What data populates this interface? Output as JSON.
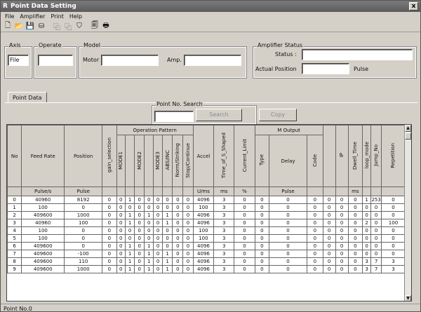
{
  "window": {
    "title": "Point Data Setting",
    "app_icon": "R",
    "close_label": "x"
  },
  "menu": [
    "File",
    "Amplifier",
    "Print",
    "Help"
  ],
  "toolbar": {
    "icons": [
      "new-file-icon",
      "open-folder-icon",
      "save-icon",
      "read-icon",
      "copy-icon",
      "paste-icon",
      "filter-icon",
      "print-preview-icon",
      "print-icon"
    ],
    "glyphs": [
      "🗋",
      "📂",
      "💾",
      "⛁",
      "⿻",
      "⿻",
      "⛉",
      "🗐",
      "🖶"
    ]
  },
  "axis": {
    "label": "Axis",
    "value": "File"
  },
  "operate": {
    "label": "Operate",
    "value": ""
  },
  "model": {
    "label": "Model",
    "motor_label": "Motor",
    "motor_value": "",
    "amp_label": "Amp.",
    "amp_value": ""
  },
  "amp_status": {
    "label": "Amplifier Status",
    "status_label": "Status :",
    "status_value": "",
    "pos_label": "Actual Position",
    "pos_value": "",
    "unit": "Pulse"
  },
  "tab": {
    "label": "Point Data"
  },
  "search": {
    "label": "Point No. Search",
    "value": "",
    "button": "Search"
  },
  "copy_button": "Copy",
  "grid": {
    "group_op": "Operation Pattern",
    "group_m": "M Output",
    "headers": [
      "No",
      "Feed Rate",
      "Position",
      "gain_selection",
      "MODE1",
      "",
      "MODE2",
      "",
      "MODE3",
      "ABS/INC",
      "Norm/Striking",
      "Stop/Continue",
      "Accel",
      "Time_of_S_Shaped",
      "Current_Limit",
      "Type",
      "Delay",
      "Code",
      "",
      "IP",
      "Dwell_Time",
      "loop_mode",
      "Jump_No",
      "Repetition"
    ],
    "units": [
      "",
      "Pulse/s",
      "Pulse",
      "",
      "",
      "",
      "",
      "",
      "",
      "",
      "",
      "",
      "U/ms",
      "ms",
      "%",
      "",
      "Pulse",
      "",
      "",
      "",
      "ms",
      "",
      "",
      ""
    ],
    "rows": [
      [
        "0",
        "40960",
        "8192",
        "0",
        "0",
        "1",
        "0",
        "0",
        "0",
        "0",
        "0",
        "0",
        "4096",
        "3",
        "0",
        "0",
        "0",
        "0",
        "0",
        "0",
        "0",
        "1",
        "253",
        "0"
      ],
      [
        "1",
        "100",
        "0",
        "0",
        "0",
        "0",
        "0",
        "0",
        "0",
        "0",
        "0",
        "0",
        "100",
        "3",
        "0",
        "0",
        "0",
        "0",
        "0",
        "0",
        "0",
        "0",
        "0",
        "0"
      ],
      [
        "2",
        "409600",
        "1000",
        "0",
        "0",
        "1",
        "0",
        "1",
        "0",
        "1",
        "0",
        "0",
        "4096",
        "3",
        "0",
        "0",
        "0",
        "0",
        "0",
        "0",
        "0",
        "0",
        "0",
        "0"
      ],
      [
        "3",
        "40960",
        "100",
        "0",
        "0",
        "1",
        "0",
        "0",
        "0",
        "1",
        "0",
        "0",
        "4096",
        "3",
        "0",
        "0",
        "0",
        "0",
        "0",
        "0",
        "0",
        "2",
        "0",
        "100"
      ],
      [
        "4",
        "100",
        "0",
        "0",
        "0",
        "0",
        "0",
        "0",
        "0",
        "0",
        "0",
        "0",
        "100",
        "3",
        "0",
        "0",
        "0",
        "0",
        "0",
        "0",
        "0",
        "0",
        "0",
        "0"
      ],
      [
        "5",
        "100",
        "0",
        "0",
        "0",
        "0",
        "0",
        "0",
        "0",
        "0",
        "0",
        "0",
        "100",
        "3",
        "0",
        "0",
        "0",
        "0",
        "0",
        "0",
        "0",
        "0",
        "0",
        "0"
      ],
      [
        "6",
        "409600",
        "0",
        "0",
        "0",
        "1",
        "0",
        "1",
        "0",
        "0",
        "0",
        "0",
        "4096",
        "3",
        "0",
        "0",
        "0",
        "0",
        "0",
        "0",
        "0",
        "0",
        "0",
        "0"
      ],
      [
        "7",
        "409600",
        "-100",
        "0",
        "0",
        "1",
        "0",
        "1",
        "0",
        "1",
        "0",
        "0",
        "4096",
        "3",
        "0",
        "0",
        "0",
        "0",
        "0",
        "0",
        "0",
        "0",
        "0",
        "0"
      ],
      [
        "8",
        "409600",
        "110",
        "0",
        "0",
        "1",
        "0",
        "1",
        "0",
        "1",
        "0",
        "0",
        "4096",
        "3",
        "0",
        "0",
        "0",
        "0",
        "0",
        "0",
        "0",
        "3",
        "7",
        "3"
      ],
      [
        "9",
        "409600",
        "1000",
        "0",
        "0",
        "1",
        "0",
        "1",
        "0",
        "1",
        "0",
        "0",
        "4096",
        "3",
        "0",
        "0",
        "0",
        "0",
        "0",
        "0",
        "0",
        "3",
        "7",
        "3"
      ]
    ]
  },
  "status_bar": "Point No.0"
}
